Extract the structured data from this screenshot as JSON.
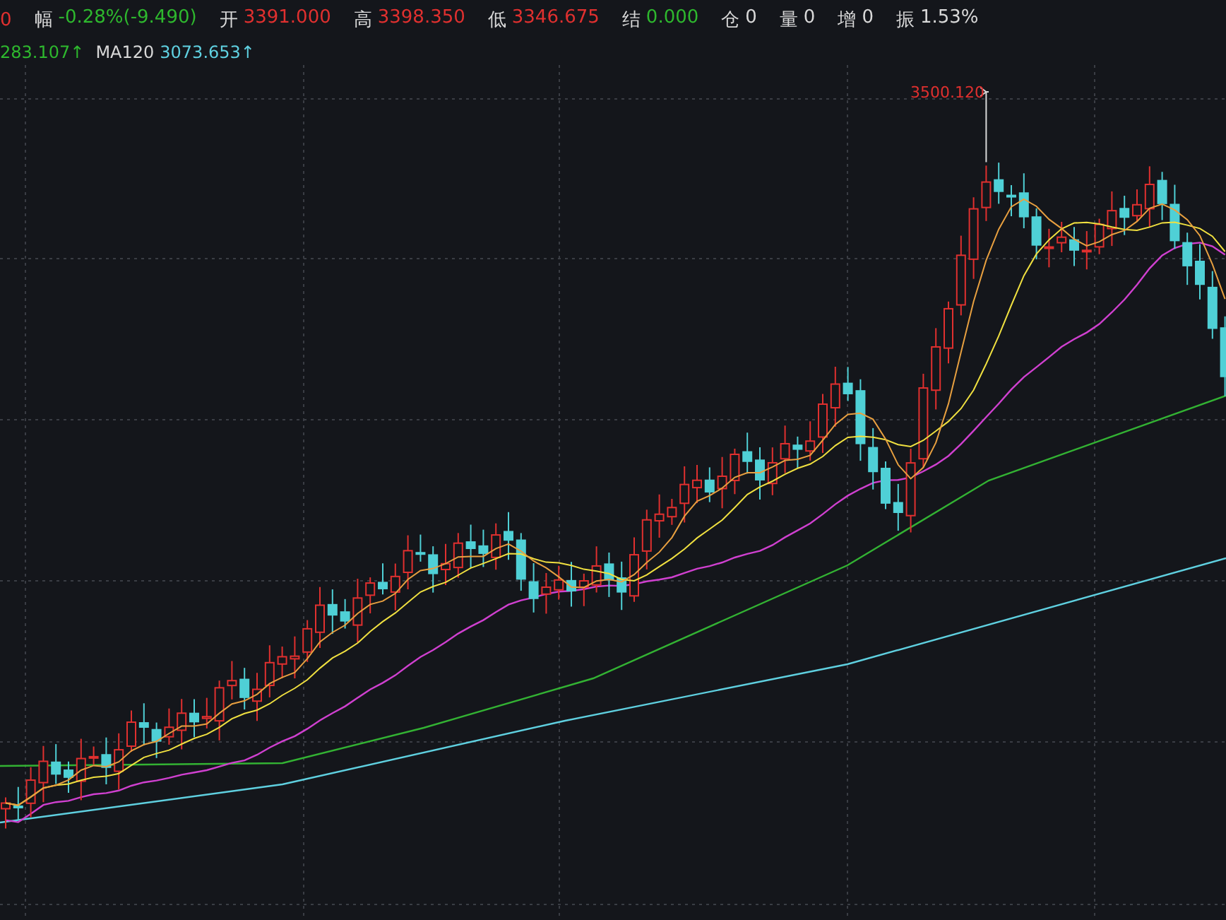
{
  "quote_bar": [
    {
      "value": "0",
      "color": "#e0302f"
    },
    {
      "label": "幅",
      "value": "-0.28%(-9.490)",
      "color": "#2eb82e"
    },
    {
      "label": "开",
      "value": "3391.000",
      "color": "#e0302f"
    },
    {
      "label": "高",
      "value": "3398.350",
      "color": "#e0302f"
    },
    {
      "label": "低",
      "value": "3346.675",
      "color": "#e0302f"
    },
    {
      "label": "结",
      "value": "0.000",
      "color": "#2eb82e"
    },
    {
      "label": "仓",
      "value": "0",
      "color": "#d8d8d8"
    },
    {
      "label": "量",
      "value": "0",
      "color": "#d8d8d8"
    },
    {
      "label": "增",
      "value": "0",
      "color": "#d8d8d8"
    },
    {
      "label": "振",
      "value": "1.53%",
      "color": "#d8d8d8"
    }
  ],
  "ma_legend": [
    {
      "value": "283.107↑",
      "color": "#2eb82e"
    },
    {
      "label": "MA120",
      "value": "3073.653↑",
      "color": "#5fd0e0"
    }
  ],
  "chart": {
    "peak_label": "3500.120"
  }
}
